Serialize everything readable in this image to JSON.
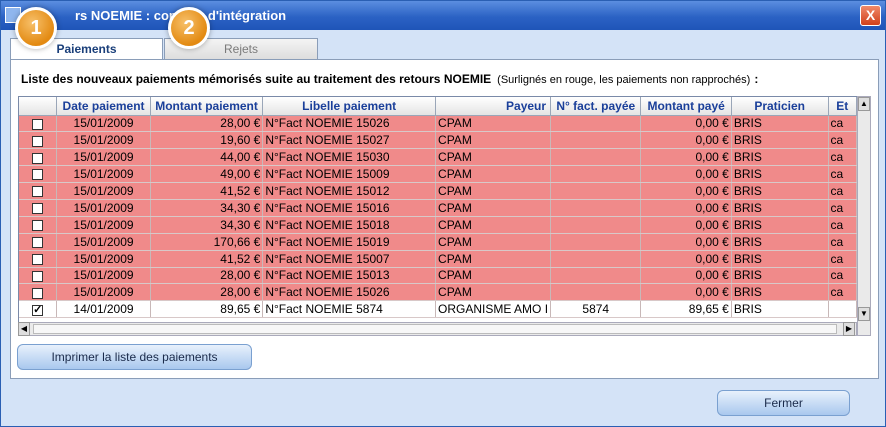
{
  "window": {
    "title": "rs NOEMIE : compt        u d'intégration",
    "close_glyph": "X"
  },
  "badges": [
    "1",
    "2"
  ],
  "tabs": [
    {
      "label": "Paiements",
      "active": true
    },
    {
      "label": "Rejets",
      "active": false
    }
  ],
  "caption": {
    "text": "Liste des nouveaux paiements mémorisés suite au traitement des retours NOEMIE",
    "note": "(Surlignés en rouge, les paiements non rapprochés)",
    "colon": ":"
  },
  "table": {
    "headers": [
      "",
      "Date paiement",
      "Montant paiement",
      "Libelle paiement",
      "Payeur",
      "N° fact. payée",
      "Montant payé",
      "Praticien",
      "Et"
    ],
    "rows": [
      {
        "checked": false,
        "date": "15/01/2009",
        "montant": "28,00 €",
        "libelle": "N°Fact NOEMIE 15026",
        "payeur": "CPAM",
        "facture": "",
        "paye": "0,00 €",
        "praticien": "BRIS",
        "etat": "ca",
        "unmatched": true
      },
      {
        "checked": false,
        "date": "15/01/2009",
        "montant": "19,60 €",
        "libelle": "N°Fact NOEMIE 15027",
        "payeur": "CPAM",
        "facture": "",
        "paye": "0,00 €",
        "praticien": "BRIS",
        "etat": "ca",
        "unmatched": true
      },
      {
        "checked": false,
        "date": "15/01/2009",
        "montant": "44,00 €",
        "libelle": "N°Fact NOEMIE 15030",
        "payeur": "CPAM",
        "facture": "",
        "paye": "0,00 €",
        "praticien": "BRIS",
        "etat": "ca",
        "unmatched": true
      },
      {
        "checked": false,
        "date": "15/01/2009",
        "montant": "49,00 €",
        "libelle": "N°Fact NOEMIE 15009",
        "payeur": "CPAM",
        "facture": "",
        "paye": "0,00 €",
        "praticien": "BRIS",
        "etat": "ca",
        "unmatched": true
      },
      {
        "checked": false,
        "date": "15/01/2009",
        "montant": "41,52 €",
        "libelle": "N°Fact NOEMIE 15012",
        "payeur": "CPAM",
        "facture": "",
        "paye": "0,00 €",
        "praticien": "BRIS",
        "etat": "ca",
        "unmatched": true
      },
      {
        "checked": false,
        "date": "15/01/2009",
        "montant": "34,30 €",
        "libelle": "N°Fact NOEMIE 15016",
        "payeur": "CPAM",
        "facture": "",
        "paye": "0,00 €",
        "praticien": "BRIS",
        "etat": "ca",
        "unmatched": true
      },
      {
        "checked": false,
        "date": "15/01/2009",
        "montant": "34,30 €",
        "libelle": "N°Fact NOEMIE 15018",
        "payeur": "CPAM",
        "facture": "",
        "paye": "0,00 €",
        "praticien": "BRIS",
        "etat": "ca",
        "unmatched": true
      },
      {
        "checked": false,
        "date": "15/01/2009",
        "montant": "170,66 €",
        "libelle": "N°Fact NOEMIE 15019",
        "payeur": "CPAM",
        "facture": "",
        "paye": "0,00 €",
        "praticien": "BRIS",
        "etat": "ca",
        "unmatched": true
      },
      {
        "checked": false,
        "date": "15/01/2009",
        "montant": "41,52 €",
        "libelle": "N°Fact NOEMIE 15007",
        "payeur": "CPAM",
        "facture": "",
        "paye": "0,00 €",
        "praticien": "BRIS",
        "etat": "ca",
        "unmatched": true
      },
      {
        "checked": false,
        "date": "15/01/2009",
        "montant": "28,00 €",
        "libelle": "N°Fact NOEMIE 15013",
        "payeur": "CPAM",
        "facture": "",
        "paye": "0,00 €",
        "praticien": "BRIS",
        "etat": "ca",
        "unmatched": true
      },
      {
        "checked": false,
        "date": "15/01/2009",
        "montant": "28,00 €",
        "libelle": "N°Fact NOEMIE 15026",
        "payeur": "CPAM",
        "facture": "",
        "paye": "0,00 €",
        "praticien": "BRIS",
        "etat": "ca",
        "unmatched": true
      },
      {
        "checked": true,
        "date": "14/01/2009",
        "montant": "89,65 €",
        "libelle": "N°Fact NOEMIE 5874",
        "payeur": "ORGANISME AMO I",
        "facture": "5874",
        "paye": "89,65 €",
        "praticien": "BRIS",
        "etat": "",
        "unmatched": false
      }
    ]
  },
  "scroll": {
    "up": "▲",
    "down": "▼",
    "left": "◀",
    "right": "▶"
  },
  "buttons": {
    "print_label": "Imprimer la liste des paiements",
    "close_label": "Fermer"
  },
  "colors": {
    "unmatched_row": "#f08a8a",
    "header_text": "#1a3f9a",
    "badge": "#e38a12"
  }
}
